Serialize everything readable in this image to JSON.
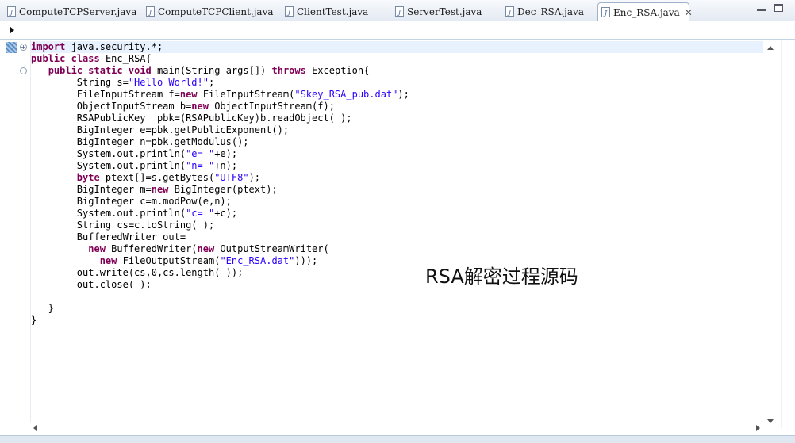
{
  "tabs": [
    {
      "label": "ComputeTCPServer.java",
      "active": false
    },
    {
      "label": "ComputeTCPClient.java",
      "active": false
    },
    {
      "label": "ClientTest.java",
      "active": false
    },
    {
      "label": "ServerTest.java",
      "active": false
    },
    {
      "label": "Dec_RSA.java",
      "active": false
    },
    {
      "label": "Enc_RSA.java",
      "active": true
    }
  ],
  "icons": {
    "java_file": "java-file-icon",
    "close": "close-icon",
    "minimize": "minimize-icon",
    "maximize": "maximize-icon",
    "breadcrumb": "chevron-right-icon",
    "fold": "fold-toggle-icon"
  },
  "tab_close_glyph": "✕",
  "fold_glyphs": {
    "collapsed": "+",
    "expanded": "−"
  },
  "code_lines": [
    [
      {
        "t": "import",
        "k": "kw"
      },
      {
        "t": " java.security.*;",
        "k": ""
      }
    ],
    [
      {
        "t": "public",
        "k": "kw"
      },
      {
        "t": " ",
        "k": ""
      },
      {
        "t": "class",
        "k": "kw"
      },
      {
        "t": " Enc_RSA{",
        "k": ""
      }
    ],
    [
      {
        "t": "   ",
        "k": ""
      },
      {
        "t": "public",
        "k": "kw"
      },
      {
        "t": " ",
        "k": ""
      },
      {
        "t": "static",
        "k": "kw"
      },
      {
        "t": " ",
        "k": ""
      },
      {
        "t": "void",
        "k": "kw"
      },
      {
        "t": " main(String args[]) ",
        "k": ""
      },
      {
        "t": "throws",
        "k": "kw"
      },
      {
        "t": " Exception{",
        "k": ""
      }
    ],
    [
      {
        "t": "        String s=",
        "k": ""
      },
      {
        "t": "\"Hello World!\"",
        "k": "str"
      },
      {
        "t": ";",
        "k": ""
      }
    ],
    [
      {
        "t": "        FileInputStream f=",
        "k": ""
      },
      {
        "t": "new",
        "k": "kw"
      },
      {
        "t": " FileInputStream(",
        "k": ""
      },
      {
        "t": "\"Skey_RSA_pub.dat\"",
        "k": "str"
      },
      {
        "t": ");",
        "k": ""
      }
    ],
    [
      {
        "t": "        ObjectInputStream b=",
        "k": ""
      },
      {
        "t": "new",
        "k": "kw"
      },
      {
        "t": " ObjectInputStream(f);",
        "k": ""
      }
    ],
    [
      {
        "t": "        RSAPublicKey  pbk=(RSAPublicKey)b.readObject( );",
        "k": ""
      }
    ],
    [
      {
        "t": "        BigInteger e=pbk.getPublicExponent();",
        "k": ""
      }
    ],
    [
      {
        "t": "        BigInteger n=pbk.getModulus();",
        "k": ""
      }
    ],
    [
      {
        "t": "        System.out.println(",
        "k": ""
      },
      {
        "t": "\"e= \"",
        "k": "str"
      },
      {
        "t": "+e);",
        "k": ""
      }
    ],
    [
      {
        "t": "        System.out.println(",
        "k": ""
      },
      {
        "t": "\"n= \"",
        "k": "str"
      },
      {
        "t": "+n);",
        "k": ""
      }
    ],
    [
      {
        "t": "        ",
        "k": ""
      },
      {
        "t": "byte",
        "k": "kw"
      },
      {
        "t": " ptext[]=s.getBytes(",
        "k": ""
      },
      {
        "t": "\"UTF8\"",
        "k": "str"
      },
      {
        "t": ");",
        "k": ""
      }
    ],
    [
      {
        "t": "        BigInteger m=",
        "k": ""
      },
      {
        "t": "new",
        "k": "kw"
      },
      {
        "t": " BigInteger(ptext);",
        "k": ""
      }
    ],
    [
      {
        "t": "        BigInteger c=m.modPow(e,n);",
        "k": ""
      }
    ],
    [
      {
        "t": "        System.out.println(",
        "k": ""
      },
      {
        "t": "\"c= \"",
        "k": "str"
      },
      {
        "t": "+c);",
        "k": ""
      }
    ],
    [
      {
        "t": "        String cs=c.toString( );",
        "k": ""
      }
    ],
    [
      {
        "t": "        BufferedWriter out=",
        "k": ""
      }
    ],
    [
      {
        "t": "          ",
        "k": ""
      },
      {
        "t": "new",
        "k": "kw"
      },
      {
        "t": " BufferedWriter(",
        "k": ""
      },
      {
        "t": "new",
        "k": "kw"
      },
      {
        "t": " OutputStreamWriter(",
        "k": ""
      }
    ],
    [
      {
        "t": "            ",
        "k": ""
      },
      {
        "t": "new",
        "k": "kw"
      },
      {
        "t": " FileOutputStream(",
        "k": ""
      },
      {
        "t": "\"Enc_RSA.dat\"",
        "k": "str"
      },
      {
        "t": ")));",
        "k": ""
      }
    ],
    [
      {
        "t": "        out.write(cs,0,cs.length( ));",
        "k": ""
      }
    ],
    [
      {
        "t": "        out.close( );",
        "k": ""
      }
    ],
    [
      {
        "t": "",
        "k": ""
      }
    ],
    [
      {
        "t": "   }",
        "k": ""
      }
    ],
    [
      {
        "t": "}",
        "k": ""
      }
    ]
  ],
  "caption": "RSA解密过程源码",
  "colors": {
    "keyword": "#7f0055",
    "string": "#2a00ff",
    "current_line": "#e8f2fe",
    "tab_border": "#9fb2cc"
  }
}
